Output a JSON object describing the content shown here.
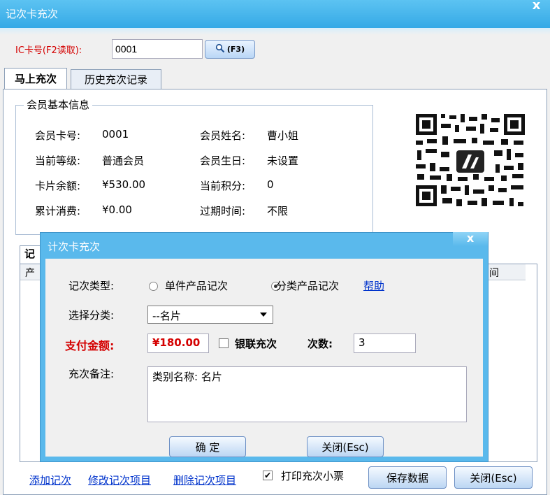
{
  "window": {
    "title": "记次卡充次",
    "close_glyph": "x"
  },
  "card": {
    "label": "IC卡号(F2读取):",
    "value": "0001",
    "read_button": "(F3)"
  },
  "tabs": [
    {
      "label": "马上充次"
    },
    {
      "label": "历史充次记录"
    }
  ],
  "member": {
    "legend": "会员基本信息",
    "fields": [
      {
        "label": "会员卡号:",
        "value": "0001"
      },
      {
        "label": "会员姓名:",
        "value": "曹小姐"
      },
      {
        "label": "当前等级:",
        "value": "普通会员"
      },
      {
        "label": "会员生日:",
        "value": "未设置"
      },
      {
        "label": "卡片余额:",
        "value": "¥530.00"
      },
      {
        "label": "当前积分:",
        "value": "0"
      },
      {
        "label": "累计消费:",
        "value": "¥0.00"
      },
      {
        "label": "过期时间:",
        "value": "不限"
      }
    ]
  },
  "records": {
    "tab_label": "记",
    "col_first": "产",
    "col_last": "间"
  },
  "bottom": {
    "add_link": "添加记次",
    "edit_link": "修改记次项目",
    "delete_link": "删除记次项目",
    "print_label": "打印充次小票",
    "print_checked": true,
    "save_button": "保存数据",
    "close_button": "关闭(Esc)"
  },
  "dialog": {
    "title": "计次卡充次",
    "close_glyph": "x",
    "type_label": "记次类型:",
    "type_options": [
      "单件产品记次",
      "分类产品记次"
    ],
    "type_selected": "分类产品记次",
    "help_link": "帮助",
    "category_label": "选择分类:",
    "category_value": "--名片",
    "pay_label": "支付金额:",
    "pay_value": "¥180.00",
    "unionpay_label": "银联充次",
    "unionpay_checked": false,
    "count_label": "次数:",
    "count_value": "3",
    "remark_label": "充次备注:",
    "remark_value": "类别名称: 名片",
    "ok_button": "确  定",
    "close_button": "关闭(Esc)"
  },
  "colors": {
    "title_bar": "#35a9e6",
    "alert_red": "#d40000",
    "link_blue": "#0033cc"
  },
  "icons": {
    "read_button_icon": "magnifier-icon",
    "qr": "qr-code-icon"
  }
}
